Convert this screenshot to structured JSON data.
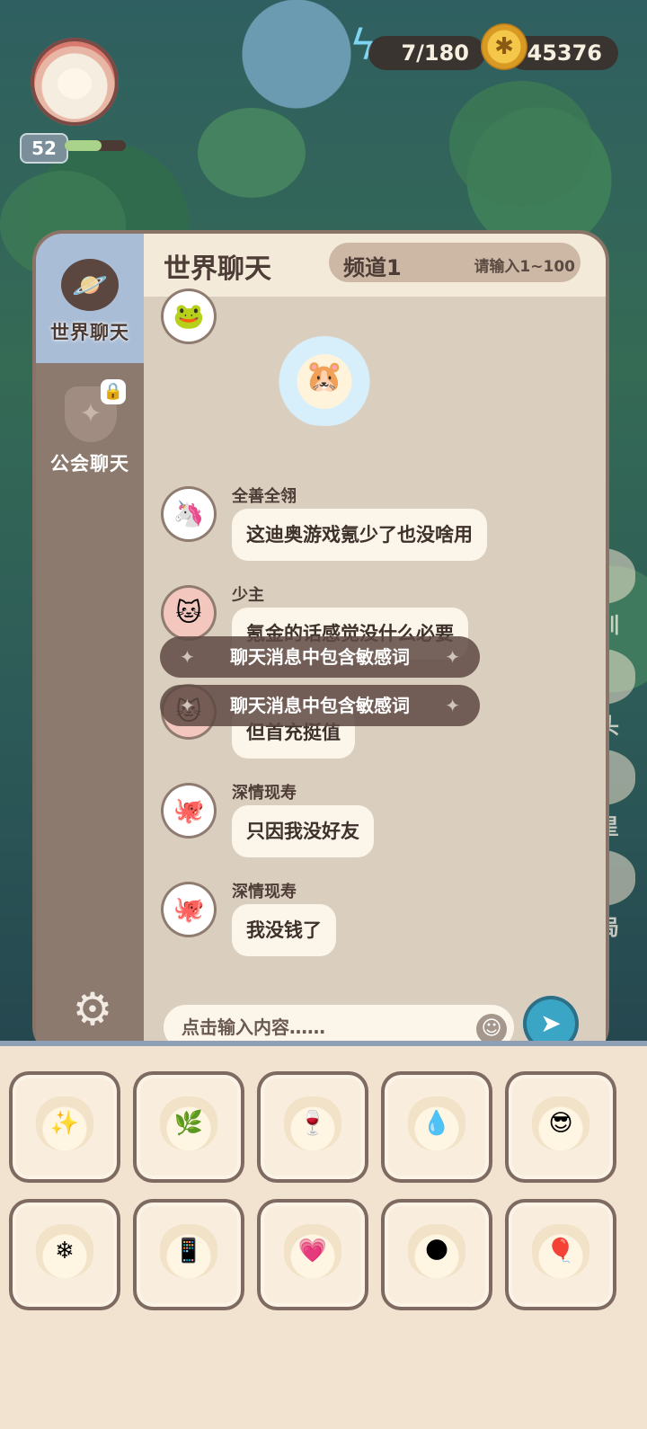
{
  "hud": {
    "level": "52",
    "level_progress": 0.6,
    "energy": "7/180",
    "coins": "45376"
  },
  "side_menu": [
    {
      "label": "特训",
      "icon": "training-icon"
    },
    {
      "label": "码头",
      "icon": "dock-icon"
    },
    {
      "label": "归星",
      "icon": "star-icon"
    },
    {
      "label": "布局",
      "icon": "layout-icon"
    }
  ],
  "chat": {
    "title": "世界聊天",
    "tabs": [
      {
        "label": "世界聊天",
        "icon": "world-icon",
        "active": true
      },
      {
        "label": "公会聊天",
        "icon": "shield-icon",
        "locked": true
      }
    ],
    "channel": "频道1",
    "channel_hint": "请输入1~100",
    "messages": [
      {
        "name": "",
        "text": "",
        "sticker": "frog-cry-sticker"
      },
      {
        "name": "全善全翎",
        "text": "这迪奥游戏氪少了也没啥用"
      },
      {
        "name": "少主",
        "text": "氪金的话感觉没什么必要"
      },
      {
        "name": "",
        "text": "但首充挺值"
      },
      {
        "name": "深情现寿",
        "text": "只因我没好友"
      },
      {
        "name": "深情现寿",
        "text": "我没钱了"
      }
    ],
    "toasts": [
      "聊天消息中包含敏感词",
      "聊天消息中包含敏感词"
    ],
    "input_placeholder": "点击输入内容……"
  },
  "stickers": [
    "cheer-sticker",
    "branch-sticker",
    "wine-sticker",
    "cry-sticker",
    "sunglasses-sticker",
    "shiver-sticker",
    "phone-sticker",
    "blush-sticker",
    "dark-sticker",
    "juggle-sticker"
  ]
}
